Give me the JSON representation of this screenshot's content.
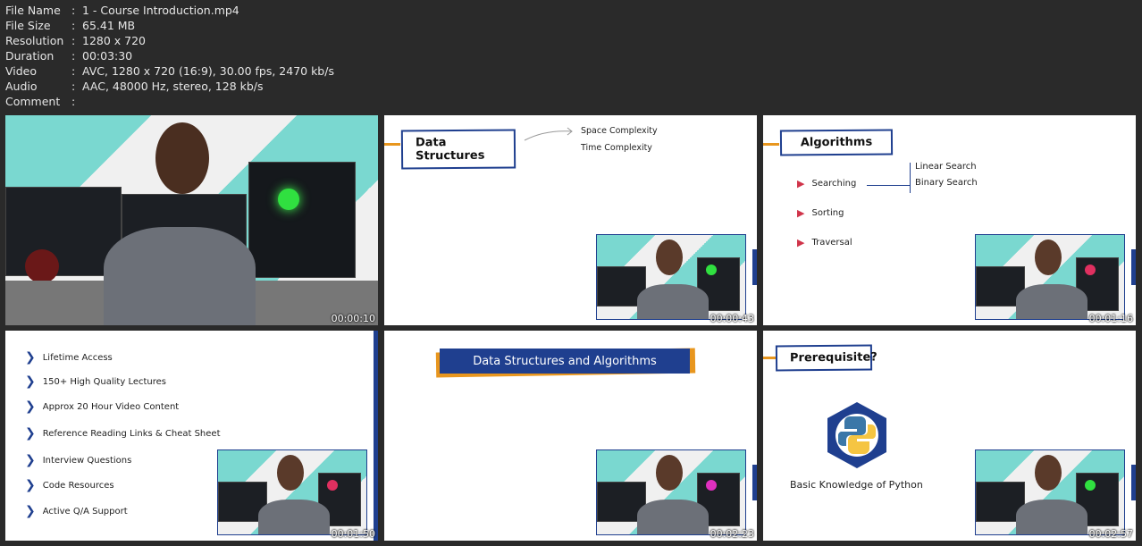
{
  "file_info": [
    {
      "key": "File Name",
      "value": "1 - Course Introduction.mp4"
    },
    {
      "key": "File Size",
      "value": "65.41 MB"
    },
    {
      "key": "Resolution",
      "value": "1280 x 720"
    },
    {
      "key": "Duration",
      "value": "00:03:30"
    },
    {
      "key": "Video",
      "value": "AVC, 1280 x 720 (16:9), 30.00 fps, 2470 kb/s"
    },
    {
      "key": "Audio",
      "value": "AAC, 48000 Hz, stereo, 128 kb/s"
    },
    {
      "key": "Comment",
      "value": ""
    }
  ],
  "separator": ":",
  "thumbnails": [
    {
      "timestamp": "00:00:10"
    },
    {
      "timestamp": "00:00:43",
      "title": "Data Structures",
      "items": [
        "Space Complexity",
        "Time Complexity"
      ]
    },
    {
      "timestamp": "00:01:16",
      "title": "Algorithms",
      "items": [
        "Searching",
        "Sorting",
        "Traversal"
      ],
      "sub_items": [
        "Linear Search",
        "Binary Search"
      ]
    },
    {
      "timestamp": "00:01:50",
      "items": [
        "Lifetime Access",
        "150+ High Quality Lectures",
        "Approx 20 Hour Video Content",
        "Reference Reading Links & Cheat Sheet",
        "Interview Questions",
        "Code Resources",
        "Active Q/A Support"
      ]
    },
    {
      "timestamp": "00:02:23",
      "title": "Data Structures and Algorithms"
    },
    {
      "timestamp": "00:02:57",
      "title": "Prerequisite?",
      "caption": "Basic Knowledge of Python"
    }
  ]
}
